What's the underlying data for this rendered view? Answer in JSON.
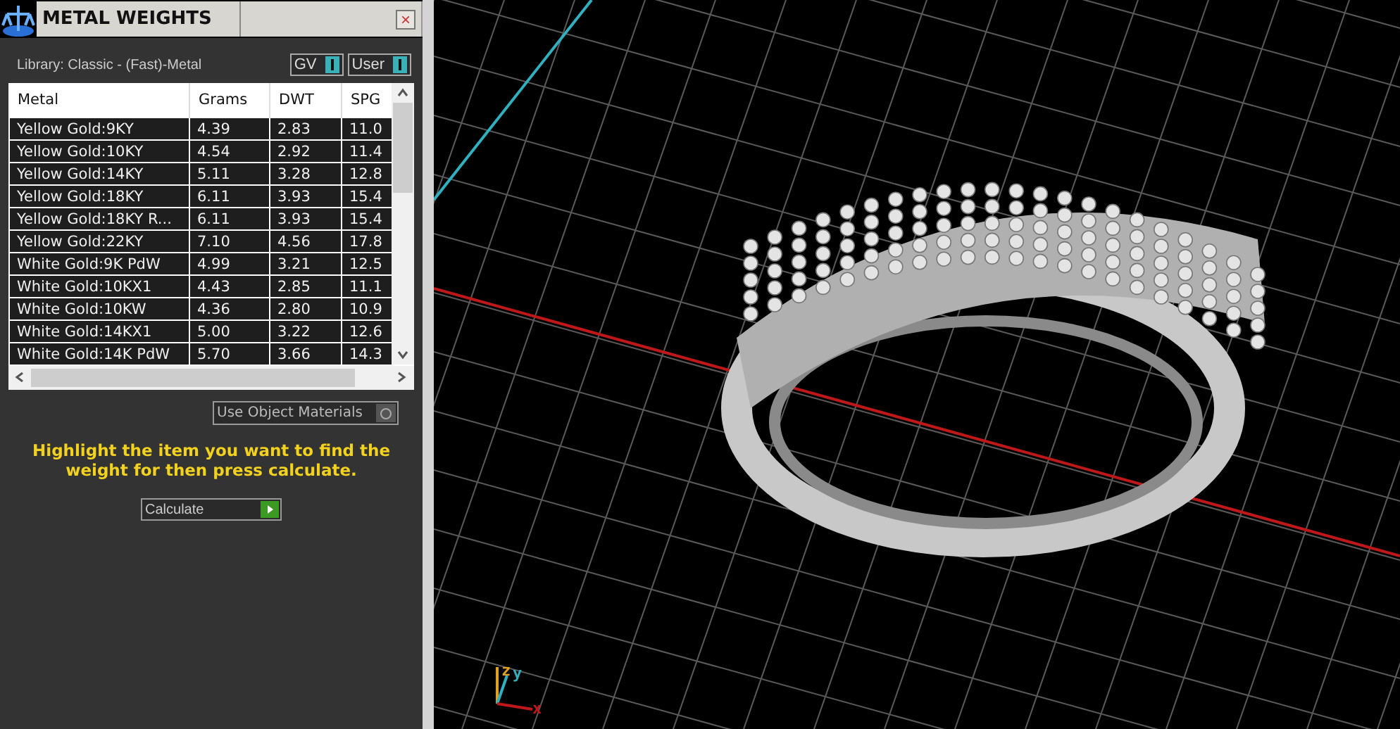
{
  "panel": {
    "title": "METAL WEIGHTS",
    "close": "×",
    "library": "Library: Classic - (Fast)-Metal",
    "toggles": [
      {
        "label": "GV",
        "on": true
      },
      {
        "label": "User",
        "on": true
      }
    ],
    "table": {
      "columns": [
        "Metal",
        "Grams",
        "DWT",
        "SPG"
      ],
      "rows": [
        [
          "Yellow Gold:9KY",
          "4.39",
          "2.83",
          "11.0"
        ],
        [
          "Yellow Gold:10KY",
          "4.54",
          "2.92",
          "11.4"
        ],
        [
          "Yellow Gold:14KY",
          "5.11",
          "3.28",
          "12.8"
        ],
        [
          "Yellow Gold:18KY",
          "6.11",
          "3.93",
          "15.4"
        ],
        [
          "Yellow Gold:18KY R...",
          "6.11",
          "3.93",
          "15.4"
        ],
        [
          "Yellow Gold:22KY",
          "7.10",
          "4.56",
          "17.8"
        ],
        [
          "White Gold:9K PdW",
          "4.99",
          "3.21",
          "12.5"
        ],
        [
          "White Gold:10KX1",
          "4.43",
          "2.85",
          "11.1"
        ],
        [
          "White Gold:10KW",
          "4.36",
          "2.80",
          "10.9"
        ],
        [
          "White Gold:14KX1",
          "5.00",
          "3.22",
          "12.6"
        ],
        [
          "White Gold:14K PdW",
          "5.70",
          "3.66",
          "14.3"
        ]
      ]
    },
    "object_materials": {
      "label": "Use Object Materials",
      "on": false
    },
    "hint": "Highlight the item you want to find the weight for then press calculate.",
    "calculate": "Calculate"
  },
  "viewport": {
    "axes": [
      "z",
      "y",
      "x"
    ]
  }
}
